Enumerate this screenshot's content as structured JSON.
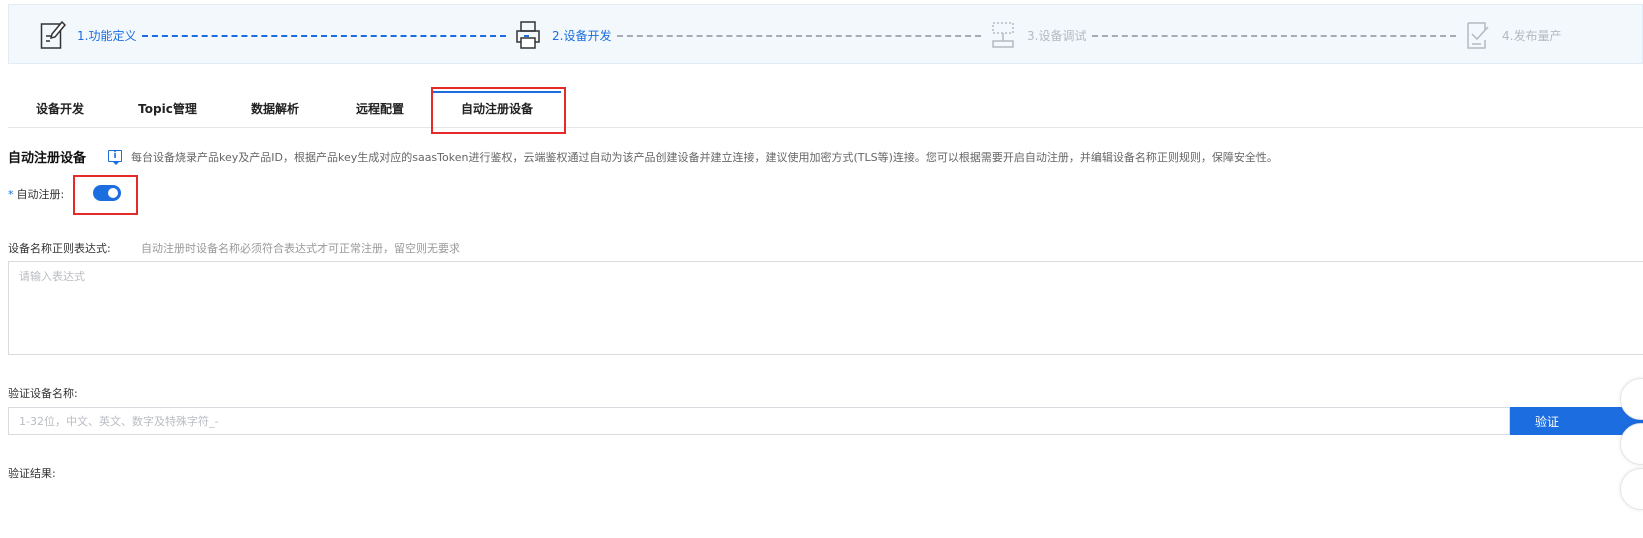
{
  "steps": [
    {
      "label": "1.功能定义",
      "state": "done",
      "icon": "edit-doc-icon"
    },
    {
      "label": "2.设备开发",
      "state": "current",
      "icon": "printer-icon"
    },
    {
      "label": "3.设备调试",
      "state": "todo",
      "icon": "debug-icon"
    },
    {
      "label": "4.发布量产",
      "state": "todo",
      "icon": "checklist-icon"
    }
  ],
  "tabs": [
    {
      "label": "设备开发"
    },
    {
      "label": "Topic管理"
    },
    {
      "label": "数据解析"
    },
    {
      "label": "远程配置"
    },
    {
      "label": "自动注册设备",
      "active": true
    }
  ],
  "section": {
    "title": "自动注册设备",
    "description": "每台设备烧录产品key及产品ID，根据产品key生成对应的saasToken进行鉴权，云端鉴权通过自动为该产品创建设备并建立连接，建议使用加密方式(TLS等)连接。您可以根据需要开启自动注册，并编辑设备名称正则规则，保障安全性。",
    "info_icon": "info-icon"
  },
  "auto_register": {
    "required_mark": "*",
    "label": "自动注册:",
    "enabled": true
  },
  "regex": {
    "label": "设备名称正则表达式:",
    "hint": "自动注册时设备名称必须符合表达式才可正常注册，留空则无要求",
    "placeholder": "请输入表达式",
    "value": ""
  },
  "verify": {
    "label": "验证设备名称:",
    "placeholder": "1-32位，中文、英文、数字及特殊字符_-",
    "value": "",
    "button_label": "验证"
  },
  "result": {
    "label": "验证结果:"
  },
  "colors": {
    "accent": "#1b6de0",
    "highlight_box": "#e62a2a",
    "step_bar_bg": "#f3f8fd",
    "inactive": "#b5b9c0"
  }
}
